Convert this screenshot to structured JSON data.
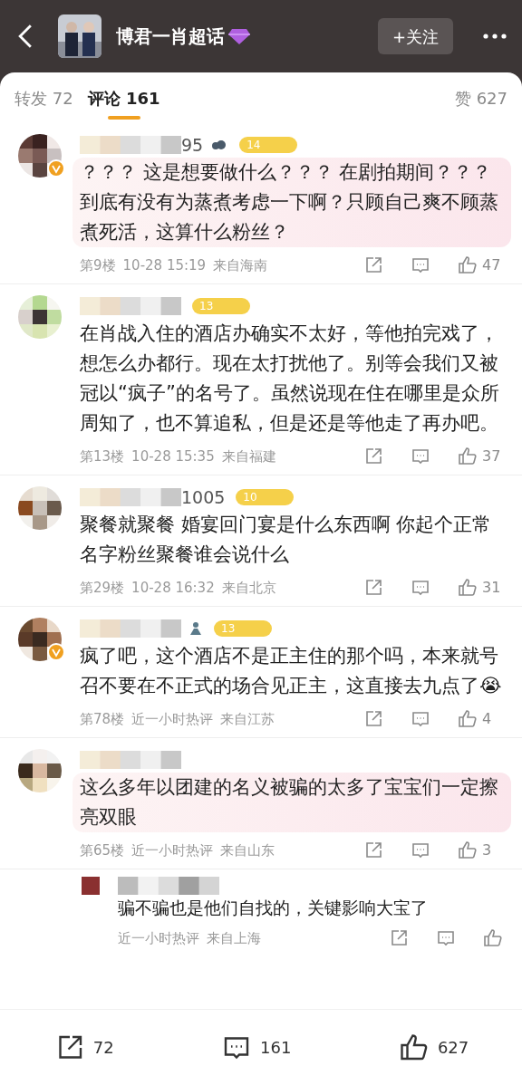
{
  "header": {
    "title": "博君一肖超话",
    "follow_button": "+关注"
  },
  "tabs": [
    {
      "label": "转发 72",
      "selected": false
    },
    {
      "label": "评论 161",
      "selected": true
    }
  ],
  "likes_tab": "赞 627",
  "comments": [
    {
      "name_fragment": "95",
      "icon": {
        "kind": "cloud"
      },
      "level": "14",
      "verified": true,
      "decorated": true,
      "text": "？？？ 这是想要做什么？？？ 在剧拍期间？？？到底有没有为蒸煮考虑一下啊？只顾自己爽不顾蒸煮死活，这算什么粉丝？",
      "floor": "第9楼",
      "time": "10-28 15:19",
      "location": "来自海南",
      "likes": "47"
    },
    {
      "level": "13",
      "verified": false,
      "decorated": false,
      "text": "在肖战入住的酒店办确实不太好，等他拍完戏了，想怎么办都行。现在太打扰他了。别等会我们又被冠以“疯子”的名号了。虽然说现在住在哪里是众所周知了，也不算追私，但是还是等他走了再办吧。",
      "floor": "第13楼",
      "time": "10-28 15:35",
      "location": "来自福建",
      "likes": "37"
    },
    {
      "name_fragment": "1005",
      "level": "10",
      "verified": false,
      "decorated": false,
      "text": "聚餐就聚餐 婚宴回门宴是什么东西啊 你起个正常名字粉丝聚餐谁会说什么",
      "floor": "第29楼",
      "time": "10-28 16:32",
      "location": "来自北京",
      "likes": "31"
    },
    {
      "icon": {
        "kind": "person"
      },
      "level": "13",
      "verified": true,
      "decorated": false,
      "text": "疯了吧，这个酒店不是正主住的那个吗，本来就号召不要在不正式的场合见正主，这直接去九点了😭",
      "floor": "第78楼",
      "time": "近一小时热评",
      "location": "来自江苏",
      "likes": "4"
    },
    {
      "verified": false,
      "decorated": true,
      "text": "这么多年以团建的名义被骗的太多了宝宝们一定擦亮双眼",
      "floor": "第65楼",
      "time": "近一小时热评",
      "location": "来自山东",
      "likes": "3"
    }
  ],
  "reply": {
    "text": "骗不骗也是他们自找的，关键影响大宝了",
    "time": "近一小时热评",
    "location": "来自上海"
  },
  "bottom_bar": {
    "shares": "72",
    "comments": "161",
    "likes": "627"
  }
}
